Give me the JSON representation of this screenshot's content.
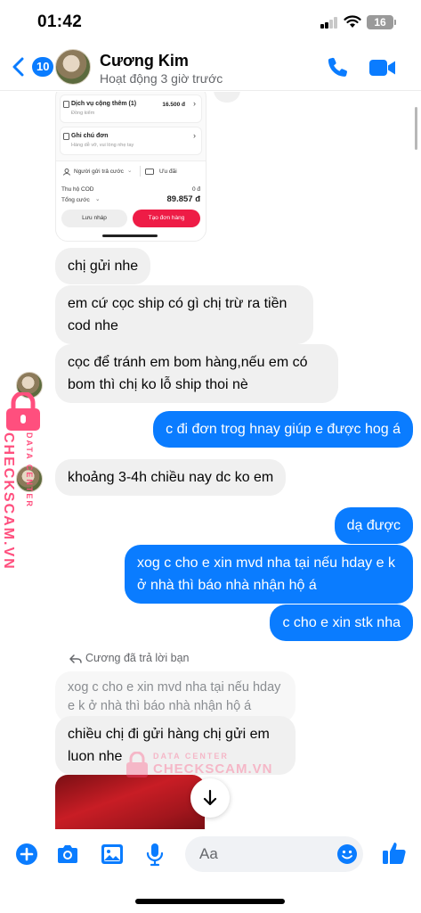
{
  "status_bar": {
    "time": "01:42",
    "battery": "16"
  },
  "header": {
    "back_badge": "10",
    "name": "Cương Kim",
    "activity": "Hoạt động 3 giờ trước"
  },
  "attachment": {
    "row1_title": "Dịch vụ cộng thêm (1)",
    "row1_sub": "Đồng kiểm",
    "row1_value": "16.500 đ",
    "row2_title": "Ghi chú đơn",
    "row2_sub": "Hàng dễ vỡ, vui lòng nhẹ tay",
    "payer": "Người gửi trả cước",
    "promo": "Ưu đãi",
    "cod_label": "Thu hộ COD",
    "cod_value": "0 đ",
    "total_label": "Tổng cước",
    "total_value": "89.857 đ",
    "draft_btn": "Lưu nháp",
    "create_btn": "Tạo đơn hàng"
  },
  "messages": [
    {
      "from": "them",
      "text": "chị gửi nhe"
    },
    {
      "from": "them",
      "text": "em cứ cọc ship có gì chị trừ ra tiền cod nhe"
    },
    {
      "from": "them",
      "text": "cọc để tránh em bom hàng,nếu em có bom thì chị ko lỗ ship thoi nè"
    },
    {
      "from": "me",
      "text": "c đi đơn trog hnay giúp e được hog á"
    },
    {
      "from": "them",
      "text": "khoảng 3-4h chiều nay dc ko em"
    },
    {
      "from": "me",
      "text": "dạ được"
    },
    {
      "from": "me",
      "text": "xog c cho e xin mvd nha tại nếu hday e k ở nhà thì báo nhà nhận hộ á"
    },
    {
      "from": "me",
      "text": "c cho e xin stk nha"
    },
    {
      "from": "them",
      "text": "chiều chị đi gửi hàng chị gửi em luon nhe"
    }
  ],
  "reply": {
    "label": "Cương đã trả lời bạn",
    "quoted": "xog c cho e xin mvd nha tại nếu hday e k ở nhà thì báo nhà nhận hộ á"
  },
  "watermark": {
    "small": "DATA CENTER",
    "big": "CHECKSCAM.VN"
  },
  "composer": {
    "placeholder": "Aa"
  },
  "colors": {
    "accent": "#0a7cff",
    "incoming": "#f0f0f0",
    "watermark": "#ff4f7e"
  }
}
